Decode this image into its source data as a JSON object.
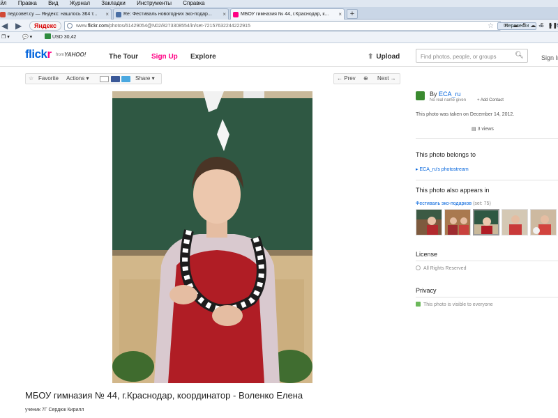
{
  "browser": {
    "menu": [
      "айл",
      "Правка",
      "Вид",
      "Журнал",
      "Закладки",
      "Инструменты",
      "Справка"
    ],
    "tabs": [
      {
        "label": "педсовет.су — Яндекс: нашлось 364 т...",
        "fav_color": "#d14836"
      },
      {
        "label": "Re: Фестиваль новогодних эко-подар...",
        "fav_color": "#4a6fa5"
      },
      {
        "label": "МБОУ гимназия № 44, г.Краснодар, к...",
        "fav_color": "#ff0084"
      }
    ],
    "new_tab": "+",
    "yandex_label": "Яндекс",
    "url_prefix": "www.",
    "url_domain": "flickr.com",
    "url_rest": "/photos/61429054@N02/8273308554/in/set-72157632244222915",
    "translate_button": "Перевести",
    "weather_1": "-5",
    "weather_2": "-5",
    "bookmark_usd": "USD 30,42"
  },
  "flickr": {
    "logo_flick": "flick",
    "logo_r": "r",
    "logo_from": "from",
    "logo_yahoo": "YAHOO!",
    "nav": {
      "tour": "The Tour",
      "signup": "Sign Up",
      "explore": "Explore"
    },
    "upload": "Upload",
    "search_placeholder": "Find photos, people, or groups",
    "sign_in": "Sign In"
  },
  "toolbar": {
    "favorite": "Favorite",
    "actions": "Actions",
    "share": "Share",
    "prev": "Prev",
    "next": "Next"
  },
  "photo": {
    "title": "МБОУ гимназия № 44, г.Краснодар, координатор - Воленко Елена",
    "description": "ученик 7Г Сердюк Кирилл"
  },
  "sidebar": {
    "by_prefix": "By",
    "owner": "ECA_ru",
    "no_real_name": "No real name given",
    "add_contact": "+ Add Contact",
    "taken": "This photo was taken on December 14, 2012.",
    "views": "3 views",
    "belongs_heading": "This photo belongs to",
    "photostream": "ECA_ru's photostream",
    "appears_heading": "This photo also appears in",
    "set_name": "Фестиваль эко-подарков",
    "set_count": "(set: 75)",
    "license_heading": "License",
    "license_value": "All Rights Reserved",
    "privacy_heading": "Privacy",
    "privacy_value": "This photo is visible to everyone"
  }
}
